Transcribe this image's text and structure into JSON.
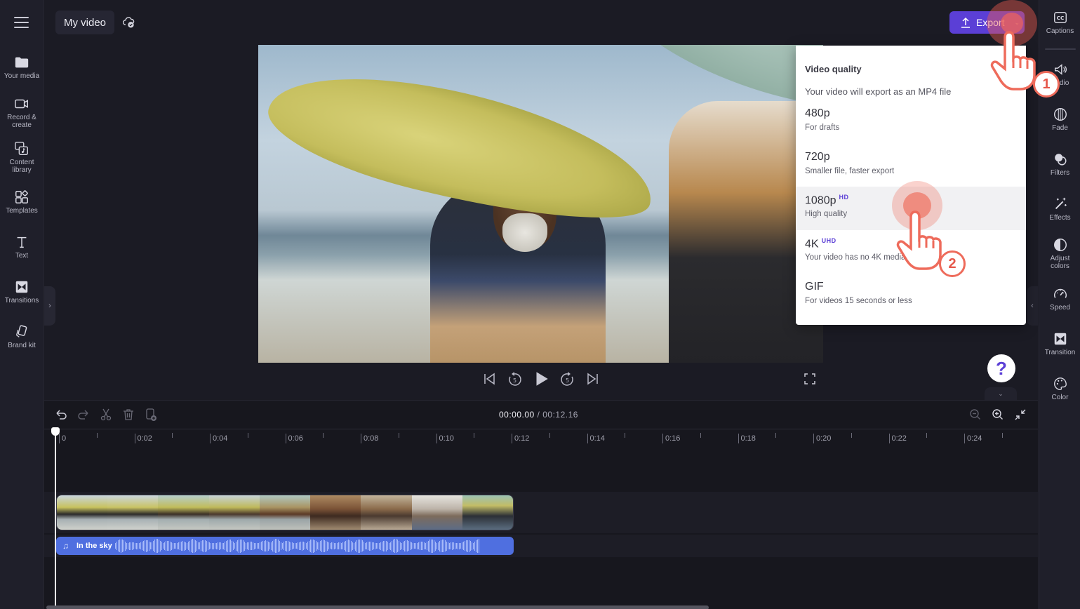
{
  "app": {
    "project_title": "My video",
    "save_status_icon": "cloud-saved-icon"
  },
  "sidebar_left": {
    "menu_icon": "hamburger-menu-icon",
    "items": [
      {
        "label": "Your media",
        "icon": "folder-icon"
      },
      {
        "label": "Record &\ncreate",
        "icon": "video-camera-icon"
      },
      {
        "label": "Content\nlibrary",
        "icon": "content-library-icon"
      },
      {
        "label": "Templates",
        "icon": "templates-icon"
      },
      {
        "label": "Text",
        "icon": "text-icon"
      },
      {
        "label": "Transitions",
        "icon": "transitions-icon"
      },
      {
        "label": "Brand kit",
        "icon": "brand-kit-icon"
      }
    ],
    "collapse_icon": "chevron-right-icon"
  },
  "export": {
    "label": "Export",
    "icon": "upload-icon",
    "chevron": "⌄"
  },
  "sidebar_right": {
    "items": [
      {
        "label": "Captions",
        "icon": "captions-icon"
      },
      {
        "label": "Audio",
        "icon": "speaker-icon"
      },
      {
        "label": "Fade",
        "icon": "fade-icon"
      },
      {
        "label": "Filters",
        "icon": "filters-icon"
      },
      {
        "label": "Effects",
        "icon": "magic-wand-icon"
      },
      {
        "label": "Adjust\ncolors",
        "icon": "adjust-colors-icon"
      },
      {
        "label": "Speed",
        "icon": "speedometer-icon"
      },
      {
        "label": "Transition",
        "icon": "transition-icon"
      },
      {
        "label": "Color",
        "icon": "palette-icon"
      }
    ],
    "collapse_icon": "chevron-left-icon"
  },
  "export_dropdown": {
    "title": "Video quality",
    "subtitle": "Your video will export as an MP4 file",
    "options": [
      {
        "name": "480p",
        "badge": "",
        "description": "For drafts",
        "hovered": false
      },
      {
        "name": "720p",
        "badge": "",
        "description": "Smaller file, faster export",
        "hovered": false
      },
      {
        "name": "1080p",
        "badge": "HD",
        "description": "High quality",
        "hovered": true
      },
      {
        "name": "4K",
        "badge": "UHD",
        "description": "Your video has no 4K media",
        "hovered": false
      },
      {
        "name": "GIF",
        "badge": "",
        "description": "For videos 15 seconds or less",
        "hovered": false
      }
    ]
  },
  "player": {
    "controls": [
      "skip-to-start-icon",
      "rewind-5-icon",
      "play-icon",
      "forward-5-icon",
      "skip-to-end-icon"
    ],
    "rewind_seconds": "5",
    "forward_seconds": "5",
    "fullscreen_icon": "fullscreen-icon",
    "help_label": "?"
  },
  "timeline": {
    "toolbar": [
      "undo-icon",
      "redo-icon",
      "split-scissors-icon",
      "delete-icon",
      "duplicate-icon"
    ],
    "current_time": "00:00.00",
    "separator": " / ",
    "total_time": "00:12.16",
    "zoom_controls": [
      "zoom-out-icon",
      "zoom-in-icon",
      "fit-to-screen-icon"
    ],
    "ruler_labels": [
      "0",
      "0:02",
      "0:04",
      "0:06",
      "0:08",
      "0:10",
      "0:12",
      "0:14",
      "0:16",
      "0:18",
      "0:20",
      "0:22",
      "0:24"
    ],
    "audio_track": {
      "name": "In the sky",
      "icon": "music-note-icon"
    }
  },
  "tutorial": {
    "step1": "1",
    "step2": "2",
    "accent": "#ee6b5b"
  },
  "colors": {
    "brand_purple": "#5b3fd6",
    "audio_blue": "#4f6fe0",
    "background": "#1b1b24"
  }
}
